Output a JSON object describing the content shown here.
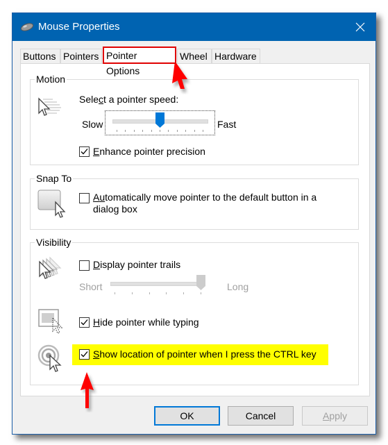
{
  "window": {
    "title": "Mouse Properties",
    "icon": "mouse-icon",
    "close_icon": "close-icon"
  },
  "tabs": [
    {
      "label": "Buttons",
      "active": false
    },
    {
      "label": "Pointers",
      "active": false
    },
    {
      "label": "Pointer Options",
      "active": true
    },
    {
      "label": "Wheel",
      "active": false
    },
    {
      "label": "Hardware",
      "active": false
    }
  ],
  "motion": {
    "group_label": "Motion",
    "icon": "pointer-speed-icon",
    "speed_label_pre": "Sele",
    "speed_label_accel": "c",
    "speed_label_post": "t a pointer speed:",
    "slow_label": "Slow",
    "fast_label": "Fast",
    "speed_ticks": 11,
    "speed_value_index": 5,
    "enhance_precision": {
      "accel": "E",
      "rest": "nhance pointer precision",
      "checked": true
    }
  },
  "snap_to": {
    "group_label": "Snap To",
    "icon": "snap-to-icon",
    "auto_move": {
      "pre": "A",
      "accel": "u",
      "rest_line1": "tomatically move pointer to the default button in a",
      "line2": "dialog box",
      "checked": false
    }
  },
  "visibility": {
    "group_label": "Visibility",
    "trails": {
      "accel": "D",
      "rest": "isplay pointer trails",
      "checked": false,
      "icon": "pointer-trails-icon"
    },
    "trails_short_label": "Short",
    "trails_long_label": "Long",
    "trails_ticks": 6,
    "trails_value_index": 5,
    "trails_enabled": false,
    "hide_typing": {
      "accel": "H",
      "rest": "ide pointer while typing",
      "checked": true,
      "icon": "hide-pointer-icon"
    },
    "show_location": {
      "accel": "S",
      "rest": "how location of pointer when I press the CTRL key",
      "checked": true,
      "icon": "pointer-location-icon",
      "highlighted": true
    }
  },
  "buttons": {
    "ok": "OK",
    "cancel": "Cancel",
    "apply_accel": "A",
    "apply_rest": "pply",
    "apply_enabled": false
  },
  "annotations": {
    "highlight_color": "#ffff00",
    "arrow_color": "#ff0000",
    "tab_box_color": "#e00000"
  },
  "colors": {
    "titlebar": "#0063b1",
    "accent": "#0078d7"
  }
}
